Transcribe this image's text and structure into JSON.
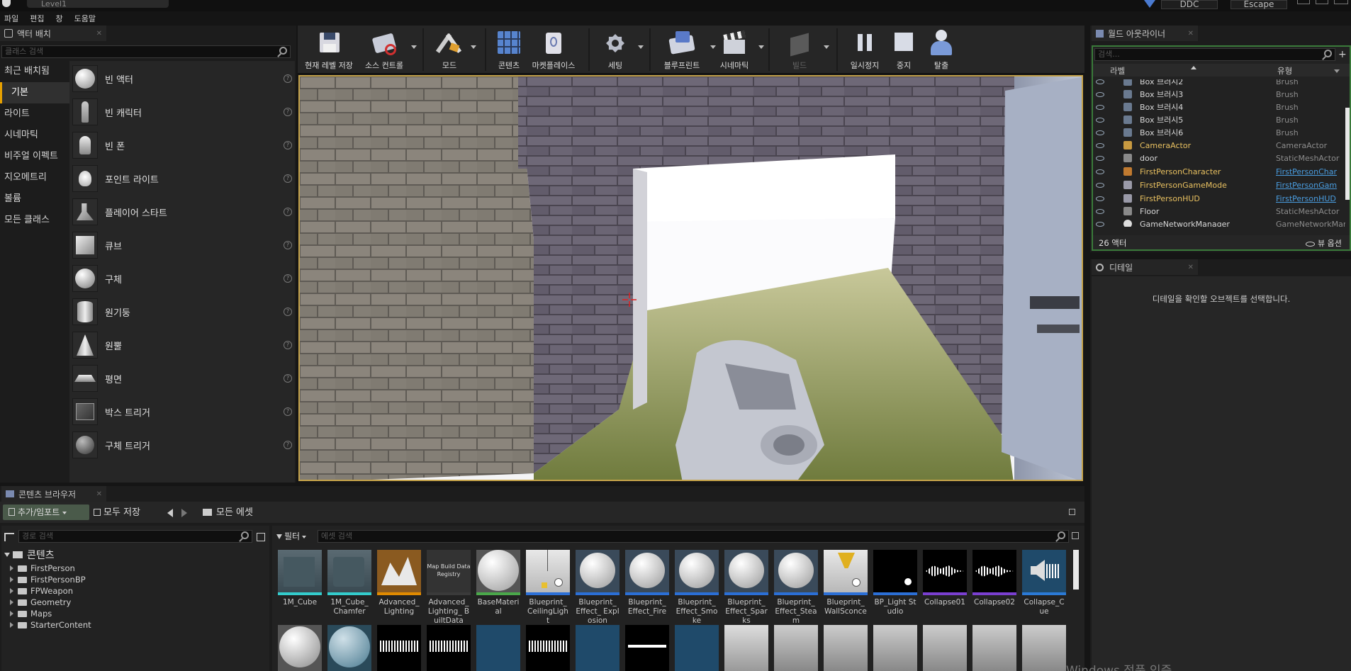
{
  "window": {
    "doc_tab": "Level1",
    "ddc_label": "DDC",
    "escape_label": "Escape"
  },
  "menu": [
    "파일",
    "편집",
    "창",
    "도움말"
  ],
  "place_actors": {
    "tab": "액터 배치",
    "search_placeholder": "클래스 검색",
    "categories": [
      "최근 배치됨",
      "기본",
      "라이트",
      "시네마틱",
      "비주얼 이펙트",
      "지오메트리",
      "볼륨",
      "모든 클래스"
    ],
    "active_category": "기본",
    "items": [
      "빈 액터",
      "빈 캐릭터",
      "빈 폰",
      "포인트 라이트",
      "플레이어 스타트",
      "큐브",
      "구체",
      "원기둥",
      "원뿔",
      "평면",
      "박스 트리거",
      "구체 트리거"
    ],
    "help_glyph": "?"
  },
  "toolbar": [
    {
      "label": "현재 레벨 저장",
      "icon": "save-icon"
    },
    {
      "label": "소스 컨트롤",
      "icon": "source-control-icon"
    },
    {
      "label": "모드",
      "icon": "modes-icon"
    },
    {
      "label": "콘텐츠",
      "icon": "content-icon"
    },
    {
      "label": "마켓플레이스",
      "icon": "marketplace-icon"
    },
    {
      "label": "세팅",
      "icon": "settings-icon"
    },
    {
      "label": "블루프린트",
      "icon": "blueprint-icon"
    },
    {
      "label": "시네마틱",
      "icon": "cinematics-icon"
    },
    {
      "label": "빌드",
      "icon": "build-icon"
    },
    {
      "label": "일시정지",
      "icon": "pause-icon"
    },
    {
      "label": "중지",
      "icon": "stop-icon"
    },
    {
      "label": "탈출",
      "icon": "eject-icon"
    }
  ],
  "world_outliner": {
    "tab": "월드 아웃라이너",
    "search_placeholder": "검색...",
    "col_label": "라벨",
    "col_type": "유형",
    "rows": [
      {
        "name": "Box 브러시2",
        "type": "Brush",
        "link": false
      },
      {
        "name": "Box 브러시3",
        "type": "Brush",
        "link": false
      },
      {
        "name": "Box 브러시4",
        "type": "Brush",
        "link": false
      },
      {
        "name": "Box 브러시5",
        "type": "Brush",
        "link": false
      },
      {
        "name": "Box 브러시6",
        "type": "Brush",
        "link": false
      },
      {
        "name": "CameraActor",
        "type": "CameraActor",
        "link": false
      },
      {
        "name": "door",
        "type": "StaticMeshActor",
        "link": false
      },
      {
        "name": "FirstPersonCharacter",
        "type": "FirstPersonChar",
        "link": true
      },
      {
        "name": "FirstPersonGameMode",
        "type": "FirstPersonGam",
        "link": true
      },
      {
        "name": "FirstPersonHUD",
        "type": "FirstPersonHUD",
        "link": true
      },
      {
        "name": "Floor",
        "type": "StaticMeshActor",
        "link": false
      },
      {
        "name": "GameNetworkManager",
        "type": "GameNetworkMar",
        "link": false
      }
    ],
    "count": "26 액터",
    "view_options": "뷰 옵션"
  },
  "details": {
    "tab": "디테일",
    "empty_message": "디테일을 확인할 오브젝트를 선택합니다."
  },
  "content_browser": {
    "tab": "콘텐츠 브라우저",
    "add_import": "추가/임포트",
    "save_all": "모두 저장",
    "path": "모든 에셋",
    "path_search_placeholder": "경로 검색",
    "filter": "필터",
    "asset_search_placeholder": "에셋 검색",
    "tree_root": "콘텐츠",
    "tree": [
      "FirstPerson",
      "FirstPersonBP",
      "FPWeapon",
      "Geometry",
      "Maps",
      "StarterContent"
    ],
    "assets": [
      {
        "name": "1M_Cube",
        "bar": "#33cccc"
      },
      {
        "name": "1M_Cube_ Chamfer",
        "bar": "#33cccc"
      },
      {
        "name": "Advanced_ Lighting",
        "bar": "#e08a00"
      },
      {
        "name": "Advanced_ Lighting_ BuiltData",
        "bar": "#3a3a3a",
        "thumb_text": "Map Build Data Registry"
      },
      {
        "name": "BaseMaterial",
        "bar": "#4aa84a"
      },
      {
        "name": "Blueprint_ CeilingLight",
        "bar": "#2b6fd6"
      },
      {
        "name": "Blueprint_ Effect_ Explosion",
        "bar": "#2b6fd6"
      },
      {
        "name": "Blueprint_ Effect_Fire",
        "bar": "#2b6fd6"
      },
      {
        "name": "Blueprint_ Effect_Smoke",
        "bar": "#2b6fd6"
      },
      {
        "name": "Blueprint_ Effect_Sparks",
        "bar": "#2b6fd6"
      },
      {
        "name": "Blueprint_ Effect_Steam",
        "bar": "#2b6fd6"
      },
      {
        "name": "Blueprint_ WallSconce",
        "bar": "#2b6fd6"
      },
      {
        "name": "BP_Light Studio",
        "bar": "#2b6fd6"
      },
      {
        "name": "Collapse01",
        "bar": "#7a3fd0"
      },
      {
        "name": "Collapse02",
        "bar": "#7a3fd0"
      },
      {
        "name": "Collapse_Cue",
        "bar": "#2b7ad6"
      }
    ]
  },
  "watermark": "Windows 정품 인증"
}
